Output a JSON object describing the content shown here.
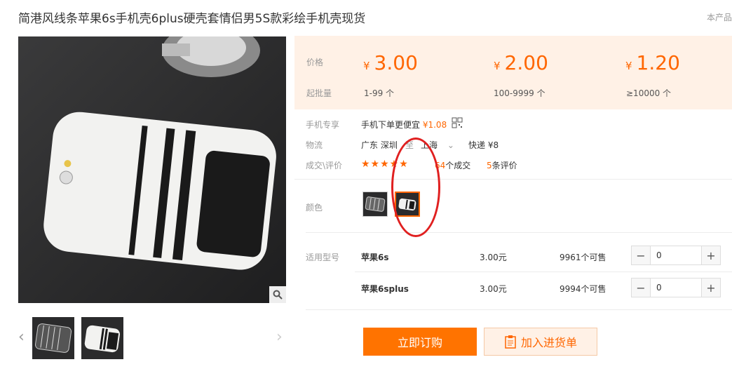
{
  "product": {
    "title": "简港风线条苹果6s手机壳6plus硬壳套情侣男5S款彩绘手机壳现货",
    "top_right": "本产品"
  },
  "price": {
    "label_price": "价格",
    "label_min": "起批量",
    "tiers": [
      {
        "currency": "¥",
        "price": "3.00",
        "range": "1-99 个"
      },
      {
        "currency": "¥",
        "price": "2.00",
        "range": "100-9999 个"
      },
      {
        "currency": "¥",
        "price": "1.20",
        "range": "≥10000 个"
      }
    ]
  },
  "mobile": {
    "label": "手机专享",
    "text": "手机下单更便宜",
    "price": "¥1.08"
  },
  "logistics": {
    "label": "物流",
    "from": "广东 深圳",
    "to_word": "至",
    "dest": "上海",
    "express": "快递 ¥8"
  },
  "deals": {
    "label": "成交\\评价",
    "stars": "★★★★★",
    "deal_count": "64",
    "deal_text": "个成交",
    "review_count": "5",
    "review_text": "条评价"
  },
  "color": {
    "label": "颜色"
  },
  "models": {
    "label": "适用型号",
    "rows": [
      {
        "name": "苹果6s",
        "price": "3.00元",
        "stock": "9961个可售",
        "qty": "0"
      },
      {
        "name": "苹果6splus",
        "price": "3.00元",
        "stock": "9994个可售",
        "qty": "0"
      }
    ]
  },
  "actions": {
    "buy": "立即订购",
    "cart": "加入进货单"
  },
  "icons": {
    "zoom": "search-icon",
    "qr": "qr-code-icon",
    "prev": "chevron-left-icon",
    "next": "chevron-right-icon",
    "dropdown": "chevron-down-icon",
    "cart": "clipboard-icon"
  },
  "colors": {
    "accent": "#ff7300",
    "price_bg": "#fff1e6",
    "annotation": "#e02020"
  }
}
